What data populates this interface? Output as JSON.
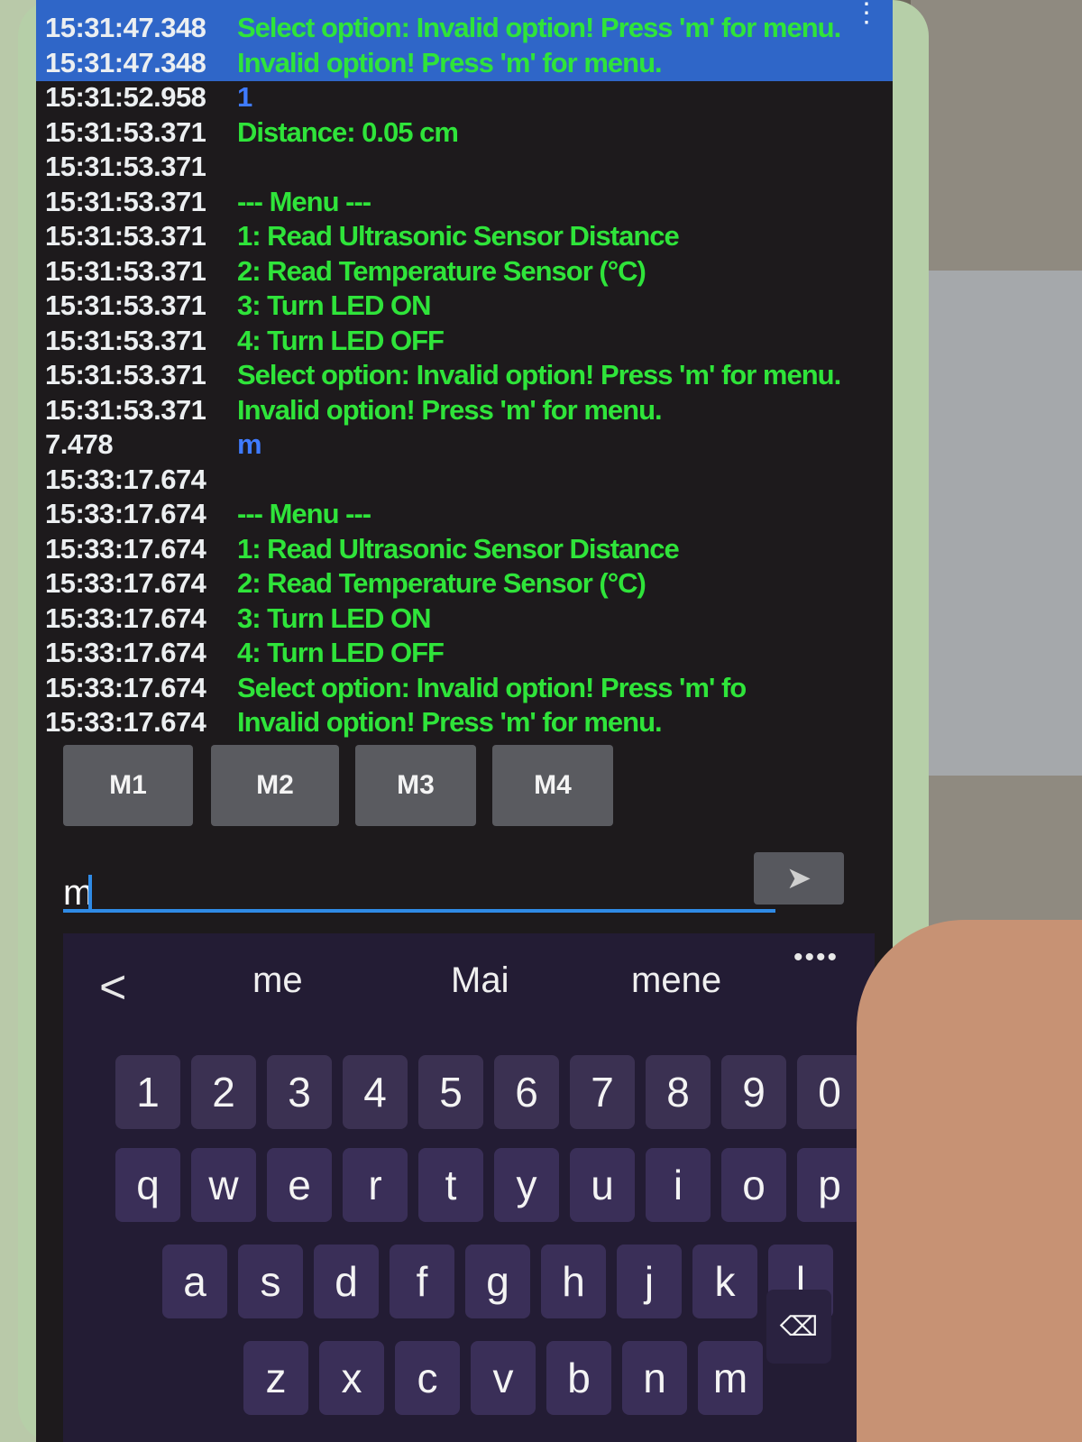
{
  "log": [
    {
      "ts": "15:31:47.348",
      "msg": "Select option: Invalid option! Press 'm' for menu.",
      "type": "rx"
    },
    {
      "ts": "15:31:47.348",
      "msg": "Invalid option! Press 'm' for menu.",
      "type": "rx"
    },
    {
      "ts": "15:31:52.958",
      "msg": "1",
      "type": "tx"
    },
    {
      "ts": "15:31:53.371",
      "msg": "Distance: 0.05 cm",
      "type": "rx"
    },
    {
      "ts": "15:31:53.371",
      "msg": "",
      "type": "rx"
    },
    {
      "ts": "15:31:53.371",
      "msg": "--- Menu ---",
      "type": "rx"
    },
    {
      "ts": "15:31:53.371",
      "msg": "1: Read Ultrasonic Sensor Distance",
      "type": "rx"
    },
    {
      "ts": "15:31:53.371",
      "msg": "2: Read Temperature Sensor (°C)",
      "type": "rx"
    },
    {
      "ts": "15:31:53.371",
      "msg": "3: Turn LED ON",
      "type": "rx"
    },
    {
      "ts": "15:31:53.371",
      "msg": "4: Turn LED OFF",
      "type": "rx"
    },
    {
      "ts": "15:31:53.371",
      "msg": "Select option: Invalid option! Press 'm' for menu.",
      "type": "rx"
    },
    {
      "ts": "15:31:53.371",
      "msg": "Invalid option! Press 'm' for menu.",
      "type": "rx"
    },
    {
      "ts": "7.478",
      "msg": "m",
      "type": "tx"
    },
    {
      "ts": "15:33:17.674",
      "msg": "",
      "type": "rx"
    },
    {
      "ts": "15:33:17.674",
      "msg": "--- Menu ---",
      "type": "rx"
    },
    {
      "ts": "15:33:17.674",
      "msg": "1: Read Ultrasonic Sensor Distance",
      "type": "rx"
    },
    {
      "ts": "15:33:17.674",
      "msg": "2: Read Temperature Sensor (°C)",
      "type": "rx"
    },
    {
      "ts": "15:33:17.674",
      "msg": "3: Turn LED ON",
      "type": "rx"
    },
    {
      "ts": "15:33:17.674",
      "msg": "4: Turn LED OFF",
      "type": "rx"
    },
    {
      "ts": "15:33:17.674",
      "msg": "Select option: Invalid option! Press 'm' fo",
      "type": "rx"
    },
    {
      "ts": "15:33:17.674",
      "msg": "Invalid option! Press 'm' for menu.",
      "type": "rx"
    }
  ],
  "macros": [
    "M1",
    "M2",
    "M3",
    "M4"
  ],
  "input": {
    "value": "m"
  },
  "keyboard": {
    "suggestions": [
      "me",
      "Mai",
      "mene"
    ],
    "numbers": [
      "1",
      "2",
      "3",
      "4",
      "5",
      "6",
      "7",
      "8",
      "9",
      "0"
    ],
    "row1": [
      "q",
      "w",
      "e",
      "r",
      "t",
      "y",
      "u",
      "i",
      "o",
      "p"
    ],
    "row2": [
      "a",
      "s",
      "d",
      "f",
      "g",
      "h",
      "j",
      "k",
      "l"
    ],
    "row3": [
      "z",
      "x",
      "c",
      "v",
      "b",
      "n",
      "m"
    ]
  },
  "colors": {
    "app_bar": "#2f66c8",
    "received_text": "#2fe43a",
    "sent_text": "#3f7bff",
    "timestamp": "#eceff1"
  },
  "icons": [
    "send-icon",
    "overflow-menu-icon",
    "backspace-icon",
    "suggestion-back-icon"
  ]
}
